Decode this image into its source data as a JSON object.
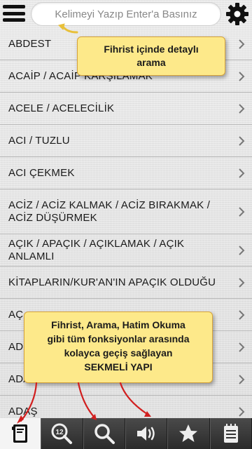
{
  "search": {
    "placeholder": "Kelimeyi Yazıp Enter'a Basınız",
    "value": ""
  },
  "index_items": [
    {
      "label": "ABDEST"
    },
    {
      "label": "ACAİP / ACAİP KARŞILAMAK"
    },
    {
      "label": "ACELE / ACELECİLİK"
    },
    {
      "label": "ACI / TUZLU"
    },
    {
      "label": "ACI ÇEKMEK"
    },
    {
      "label": "ACİZ / ACİZ KALMAK / ACİZ BIRAKMAK / ACİZ DÜŞÜRMEK"
    },
    {
      "label": "AÇIK / APAÇIK / AÇIKLAMAK / AÇIK ANLAMLI"
    },
    {
      "label": "KİTAPLARIN/KUR'AN'IN APAÇIK OLDUĞU"
    },
    {
      "label": "AÇ"
    },
    {
      "label": "AD"
    },
    {
      "label": "ADA"
    },
    {
      "label": "ADAŞ"
    }
  ],
  "callouts": {
    "search_hint": [
      "Fihrist içinde detaylı",
      "arama"
    ],
    "tabs_hint": [
      "Fihrist, Arama, Hatim Okuma",
      "gibi tüm fonksiyonlar arasında",
      "kolayca geçiş sağlayan",
      "SEKMELİ YAPI"
    ]
  },
  "tabs": [
    {
      "icon": "index-book-icon",
      "active": true
    },
    {
      "icon": "search-12-icon",
      "active": false
    },
    {
      "icon": "search-icon",
      "active": false
    },
    {
      "icon": "speaker-icon",
      "active": false
    },
    {
      "icon": "star-icon",
      "active": false
    },
    {
      "icon": "notes-icon",
      "active": false
    }
  ],
  "tab_badge": "12",
  "colors": {
    "callout_bg": "#fde98a",
    "callout_border": "#d6a33a",
    "tabbar": "#2b2b2b",
    "arrow": "#d11f1f"
  }
}
